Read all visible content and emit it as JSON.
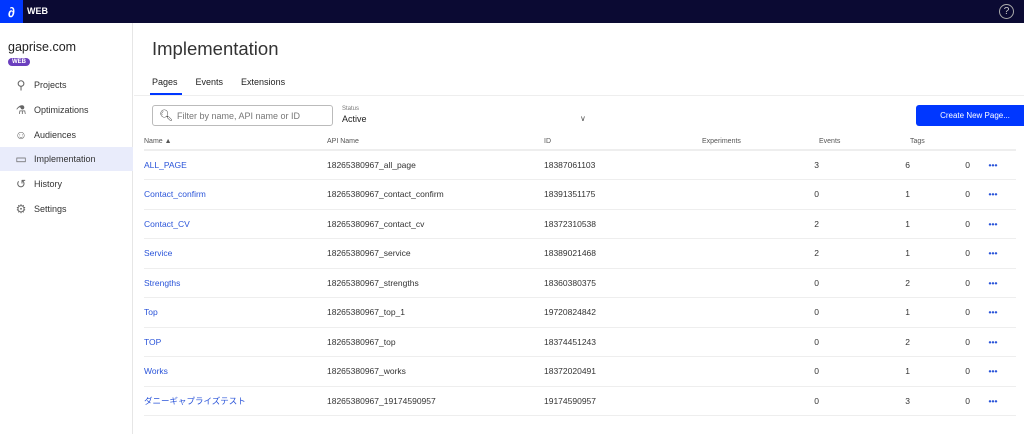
{
  "topbar": {
    "app": "WEB",
    "help": "?"
  },
  "sidebar": {
    "project": "gaprise.com",
    "badge": "WEB",
    "items": [
      {
        "label": "Projects",
        "icon": "projects-icon",
        "glyph": "⚲"
      },
      {
        "label": "Optimizations",
        "icon": "flask-icon",
        "glyph": "⚗"
      },
      {
        "label": "Audiences",
        "icon": "users-icon",
        "glyph": "☺"
      },
      {
        "label": "Implementation",
        "icon": "window-icon",
        "glyph": "▭"
      },
      {
        "label": "History",
        "icon": "history-icon",
        "glyph": "↺"
      },
      {
        "label": "Settings",
        "icon": "gear-icon",
        "glyph": "⚙"
      }
    ]
  },
  "main": {
    "title": "Implementation",
    "tabs": [
      "Pages",
      "Events",
      "Extensions"
    ],
    "search_placeholder": "Filter by name, API name or ID",
    "status_label": "Status",
    "status_value": "Active",
    "create_button": "Create New Page...",
    "columns": [
      "Name",
      "API Name",
      "ID",
      "Experiments",
      "Events",
      "Tags"
    ],
    "rows": [
      [
        "ALL_PAGE",
        "18265380967_all_page",
        "18387061103",
        "3",
        "6",
        "0"
      ],
      [
        "Contact_confirm",
        "18265380967_contact_confirm",
        "18391351175",
        "0",
        "1",
        "0"
      ],
      [
        "Contact_CV",
        "18265380967_contact_cv",
        "18372310538",
        "2",
        "1",
        "0"
      ],
      [
        "Service",
        "18265380967_service",
        "18389021468",
        "2",
        "1",
        "0"
      ],
      [
        "Strengths",
        "18265380967_strengths",
        "18360380375",
        "0",
        "2",
        "0"
      ],
      [
        "Top",
        "18265380967_top_1",
        "19720824842",
        "0",
        "1",
        "0"
      ],
      [
        "TOP",
        "18265380967_top",
        "18374451243",
        "0",
        "2",
        "0"
      ],
      [
        "Works",
        "18265380967_works",
        "18372020491",
        "0",
        "1",
        "0"
      ],
      [
        "ダニーギャプライズテスト",
        "18265380967_19174590957",
        "19174590957",
        "0",
        "3",
        "0"
      ]
    ]
  }
}
